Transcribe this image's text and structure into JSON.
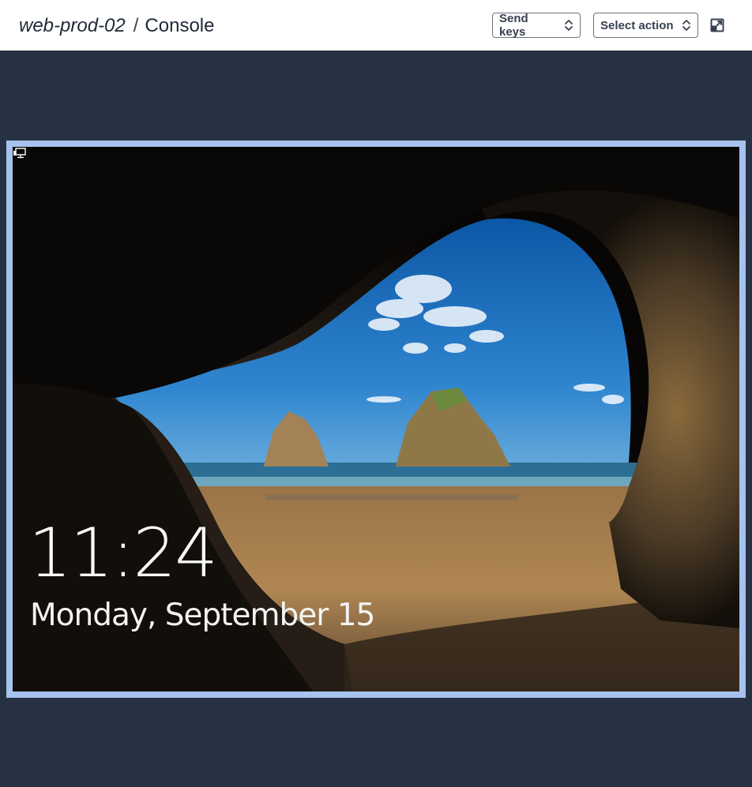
{
  "header": {
    "instance_name": "web-prod-02",
    "separator": "/",
    "page_name": "Console",
    "send_keys_label": "Send keys",
    "select_action_label": "Select action",
    "popout_icon": "external-window-icon"
  },
  "console": {
    "time": "11:24",
    "date": "Monday, September 15",
    "network_icon": "network-status-icon"
  },
  "colors": {
    "background": "#263142",
    "header_bg": "#ffffff",
    "frame_border": "#a7c3ef",
    "text": "#1f2937"
  }
}
